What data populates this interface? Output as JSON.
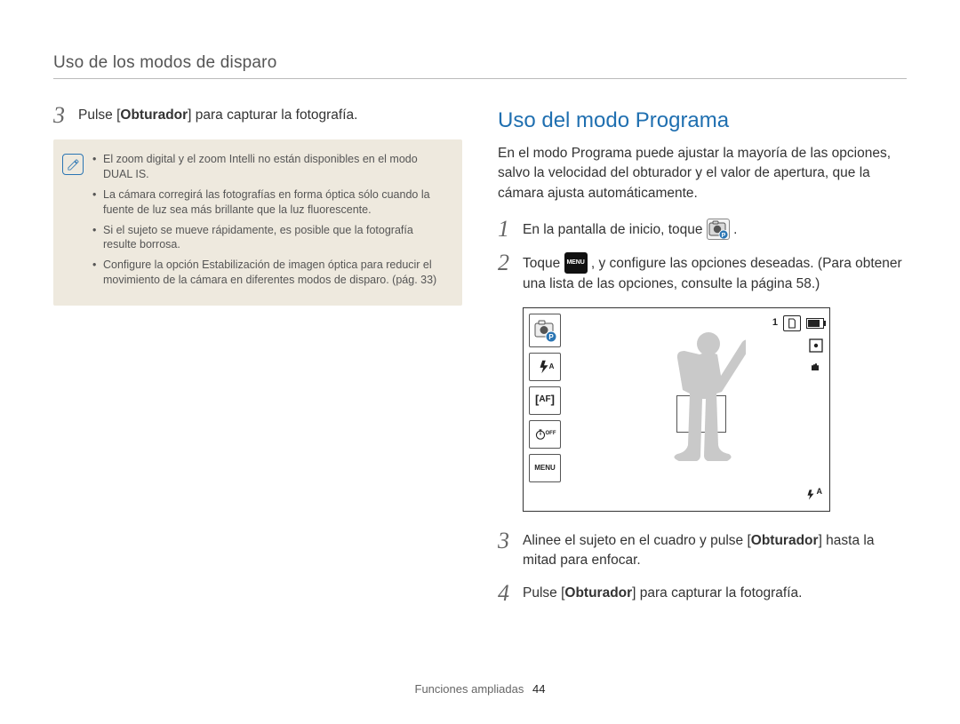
{
  "header": {
    "section": "Uso de los modos de disparo"
  },
  "left": {
    "step3_num": "3",
    "step3_text_before": "Pulse [",
    "step3_bold": "Obturador",
    "step3_text_after": "] para capturar la fotografía.",
    "notes": {
      "b1": "El zoom digital y el zoom Intelli no están disponibles en el modo DUAL IS.",
      "b2": "La cámara corregirá las fotografías en forma óptica sólo cuando la fuente de luz sea más brillante que la luz fluorescente.",
      "b3": "Si el sujeto se mueve rápidamente, es posible que la fotografía resulte borrosa.",
      "b4": "Configure la opción Estabilización de imagen óptica para reducir el movimiento de la cámara en diferentes modos de disparo. (pág. 33)"
    }
  },
  "right": {
    "title": "Uso del modo Programa",
    "intro": "En el modo Programa puede ajustar la mayoría de las opciones, salvo la velocidad del obturador y el valor de apertura, que la cámara ajusta automáticamente.",
    "icons": {
      "menu_label": "MENU"
    },
    "steps": {
      "s1_num": "1",
      "s1_text": "En la pantalla de inicio, toque ",
      "s1_after": ".",
      "s2_num": "2",
      "s2_text_before": "Toque ",
      "s2_text_mid": " , y configure las opciones deseadas. (Para obtener una lista de las opciones, consulte la página 58.)",
      "s3_num": "3",
      "s3_before": "Alinee el sujeto en el cuadro y pulse [",
      "s3_bold": "Obturador",
      "s3_after": "] hasta la mitad para enfocar.",
      "s4_num": "4",
      "s4_before": "Pulse [",
      "s4_bold": "Obturador",
      "s4_after": "] para capturar la fotografía."
    },
    "lcd": {
      "shots_remaining": "1",
      "flash_label": "A",
      "af_label": "AF",
      "off_label": "OFF",
      "menu_label": "MENU",
      "bottom_flash": "A"
    }
  },
  "footer": {
    "section": "Funciones ampliadas",
    "page": "44"
  }
}
